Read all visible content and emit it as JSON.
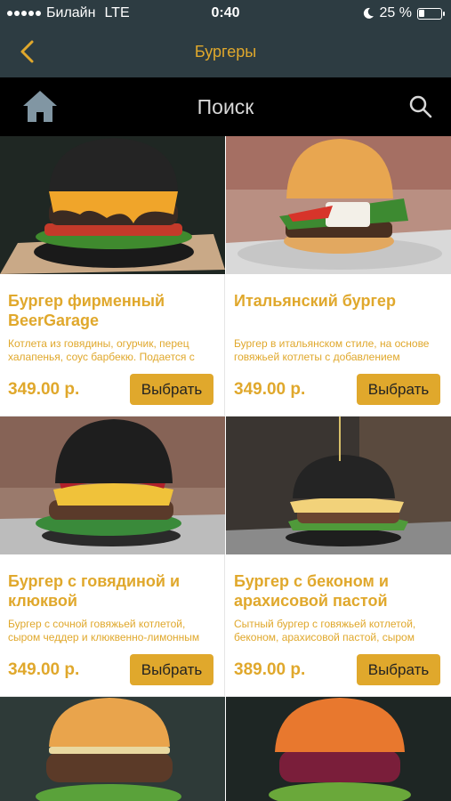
{
  "status": {
    "carrier": "Билайн",
    "network": "LTE",
    "time": "0:40",
    "battery": "25 %",
    "battery_level": 0.25
  },
  "nav": {
    "title": "Бургеры"
  },
  "search": {
    "placeholder": "Поиск"
  },
  "colors": {
    "accent": "#e0a82c",
    "header_bg": "#2d3c42",
    "search_bg": "#000000"
  },
  "products": [
    {
      "name": "Бургер фирменный BeerGarage",
      "desc": "Котлета из говядины, огурчик, перец халапенья, соус барбекю. Подается с",
      "price": "349.00 р.",
      "button": "Выбрать"
    },
    {
      "name": "Итальянский бургер",
      "desc": "Бургер в итальянском стиле, на основе говяжьей котлеты с добавлением",
      "price": "349.00 р.",
      "button": "Выбрать"
    },
    {
      "name": "Бургер с говядиной и клюквой",
      "desc": "Бургер с сочной говяжьей котлетой, сыром чеддер и клюквенно-лимонным",
      "price": "349.00 р.",
      "button": "Выбрать"
    },
    {
      "name": "Бургер с беконом и арахисовой пастой",
      "desc": "Сытный бургер с говяжьей котлетой, беконом, арахисовой пастой, сыром",
      "price": "389.00 р.",
      "button": "Выбрать"
    }
  ]
}
